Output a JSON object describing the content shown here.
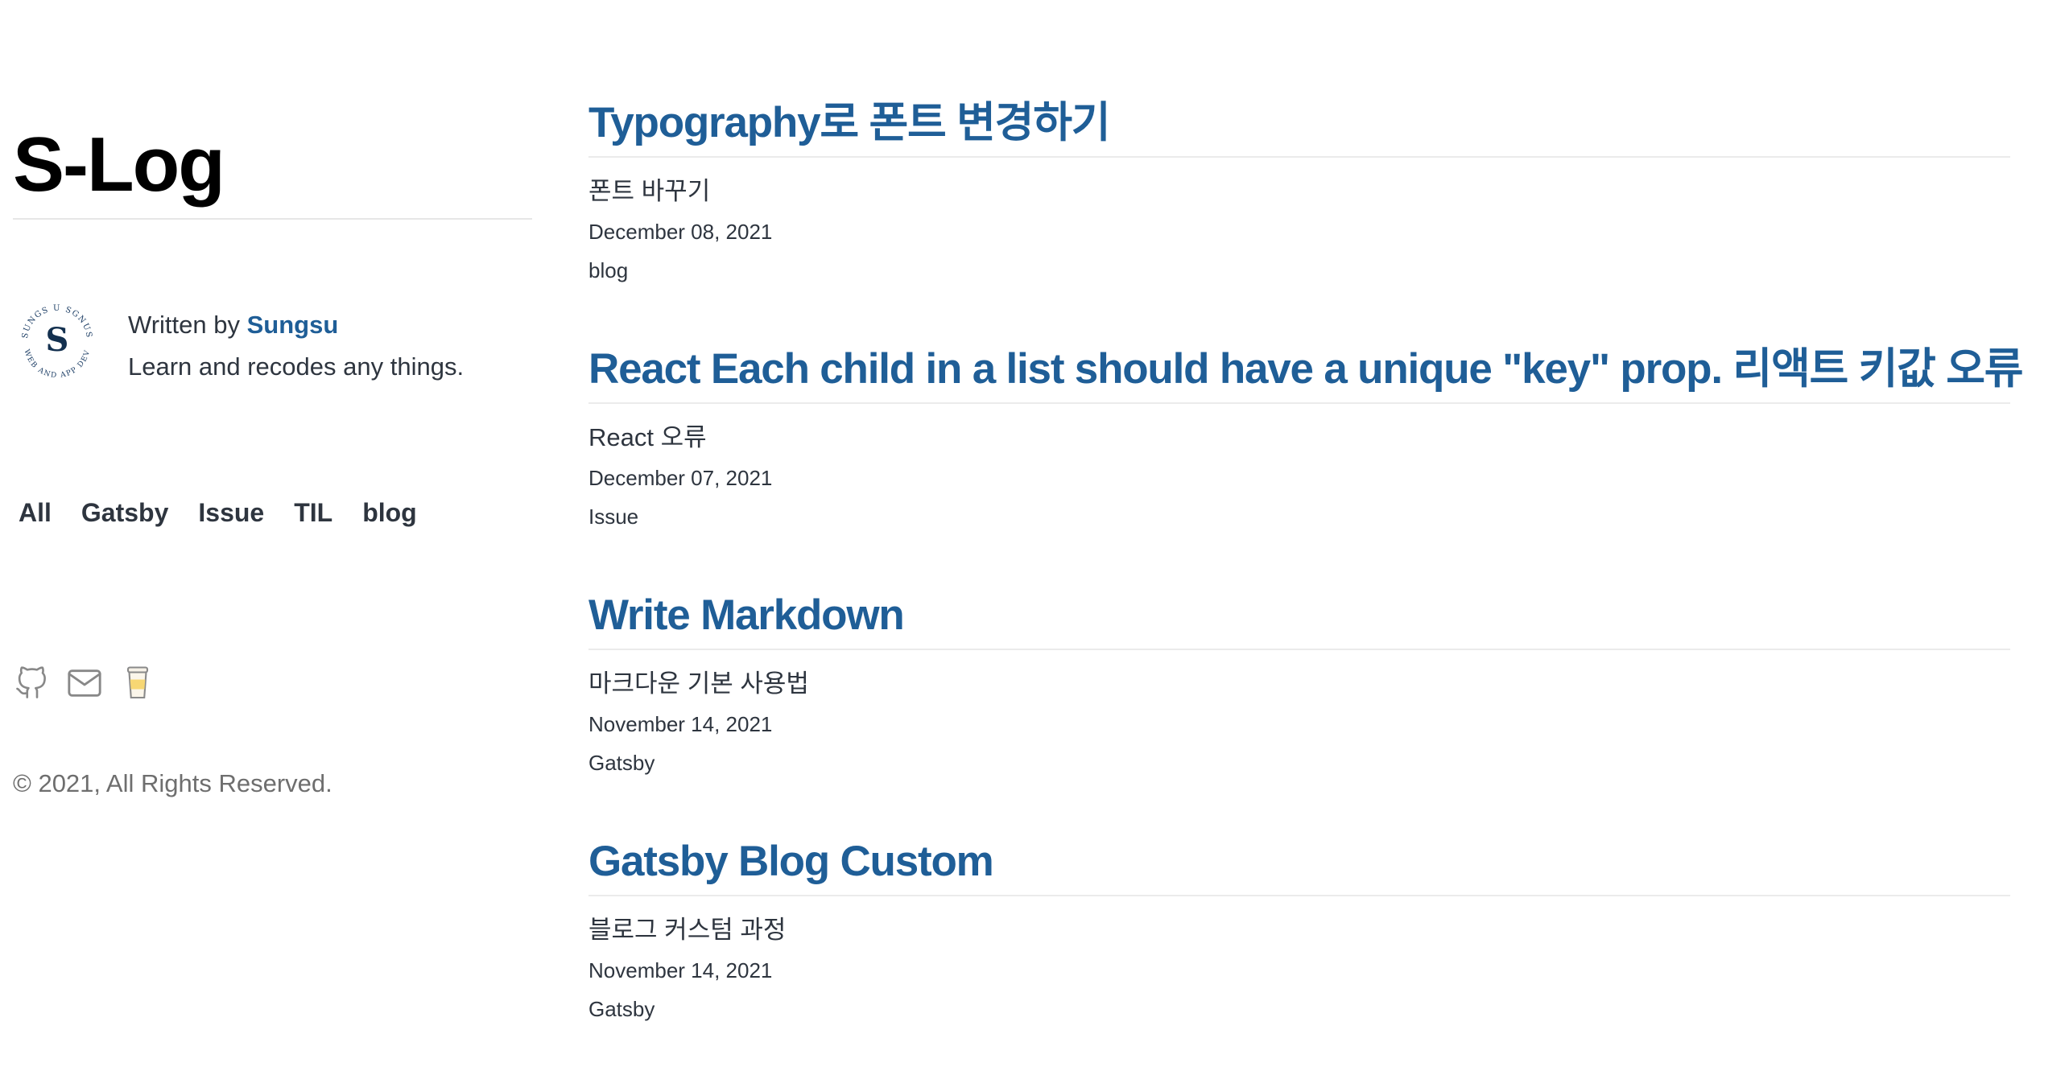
{
  "site": {
    "title": "S-Log"
  },
  "bio": {
    "written_by": "Written by ",
    "author": "Sungsu",
    "tagline": "Learn and recodes any things.",
    "avatar_letter": "S",
    "avatar_ring_top": "SUNGS U SGNUS",
    "avatar_ring_bottom": "WEB AND APP DEV"
  },
  "categories": [
    {
      "label": "All"
    },
    {
      "label": "Gatsby"
    },
    {
      "label": "Issue"
    },
    {
      "label": "TIL"
    },
    {
      "label": "blog"
    }
  ],
  "socials": [
    {
      "icon": "github-icon"
    },
    {
      "icon": "mail-icon"
    },
    {
      "icon": "coffee-icon"
    }
  ],
  "footer": {
    "copyright": "© 2021, All Rights Reserved."
  },
  "posts": [
    {
      "title": "Typography로 폰트 변경하기",
      "description": "폰트 바꾸기",
      "date": "December 08, 2021",
      "category": "blog"
    },
    {
      "title": "React Each child in a list should have a unique \"key\" prop. 리액트 키값 오류",
      "description": "React 오류",
      "date": "December 07, 2021",
      "category": "Issue"
    },
    {
      "title": "Write Markdown",
      "description": "마크다운 기본 사용법",
      "date": "November 14, 2021",
      "category": "Gatsby"
    },
    {
      "title": "Gatsby Blog Custom",
      "description": "블로그 커스텀 과정",
      "date": "November 14, 2021",
      "category": "Gatsby"
    }
  ],
  "colors": {
    "link": "#1f5e97",
    "text": "#2e353f",
    "muted": "#6e6e6e"
  }
}
